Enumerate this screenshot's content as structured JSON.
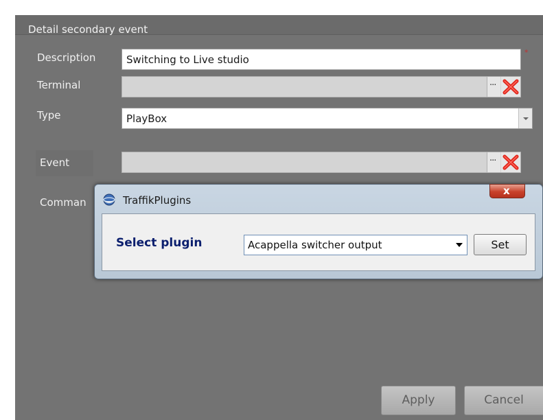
{
  "panel": {
    "title": "Detail secondary event"
  },
  "fields": {
    "description_label": "Description",
    "description_value": "Switching to Live studio",
    "terminal_label": "Terminal",
    "type_label": "Type",
    "type_value": "PlayBox",
    "event_label": "Event",
    "command_label": "Comman",
    "browse_glyph": "···",
    "required_mark": "*"
  },
  "dialog": {
    "title": "TraffikPlugins",
    "close_glyph": "x",
    "select_label": "Select plugin",
    "selected_plugin": "Acappella switcher output",
    "set_label": "Set"
  },
  "buttons": {
    "apply_label": "Apply",
    "cancel_label": "Cancel"
  },
  "icons": {
    "clear": "red-x-icon",
    "browse": "ellipsis-icon",
    "dialog_app": "globe-icon",
    "dropdown": "chevron-down-icon"
  },
  "colors": {
    "panel_bg": "#737373",
    "clear_icon": "#e0261c",
    "select_label": "#0b1f6e",
    "close_button": "#c8412b"
  }
}
